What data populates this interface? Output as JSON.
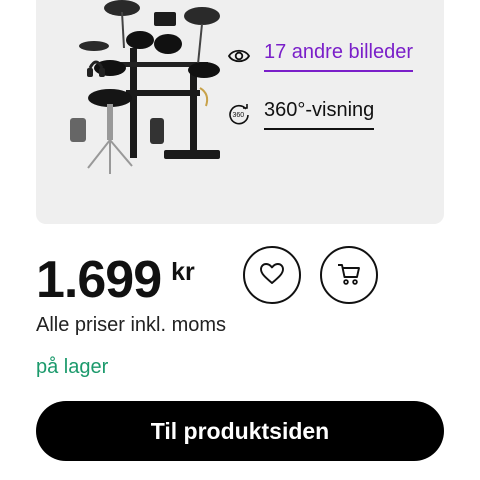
{
  "media": {
    "image_alt": "electronic-drum-kit-image",
    "more_images_label": "17 andre billeder",
    "view360_label": "360°-visning",
    "accent_color": "#7a1fc9"
  },
  "price": {
    "value": "1.699",
    "currency": "kr"
  },
  "actions": {
    "wishlist_icon": "heart-icon",
    "cart_icon": "cart-icon"
  },
  "vat_note": "Alle priser inkl. moms",
  "stock": {
    "label": "på lager",
    "color": "#1c9a6c"
  },
  "cta": {
    "label": "Til produktsiden"
  }
}
